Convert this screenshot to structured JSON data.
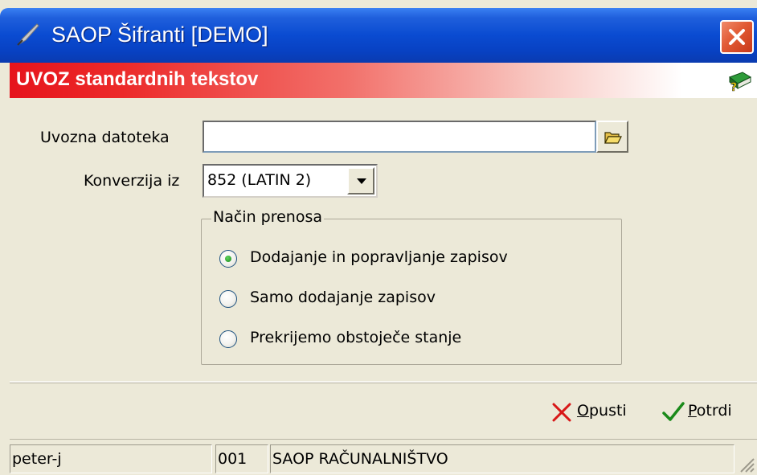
{
  "window": {
    "title": "SAOP Šifranti [DEMO]",
    "titlebar_color": "#0a4bd1",
    "close_icon": "close-icon"
  },
  "header": {
    "title": "UVOZ standardnih tekstov",
    "band_color": "#e6141c",
    "help_icon": "help-book-icon"
  },
  "form": {
    "file_label": "Uvozna datoteka",
    "file_value": "",
    "browse_icon": "folder-open-icon",
    "conversion_label": "Konverzija iz",
    "conversion_value": "852 (LATIN 2)",
    "transfer_group": {
      "legend": "Način prenosa",
      "options": [
        {
          "label": "Dodajanje in popravljanje zapisov",
          "selected": true
        },
        {
          "label": "Samo dodajanje zapisov",
          "selected": false
        },
        {
          "label": "Prekrijemo obstoječe stanje",
          "selected": false
        }
      ]
    }
  },
  "buttons": {
    "cancel": {
      "accel": "O",
      "rest": "pusti",
      "icon": "red-x-icon"
    },
    "confirm": {
      "accel": "P",
      "rest": "otrdi",
      "icon": "green-check-icon"
    }
  },
  "status": {
    "user": "peter-j",
    "company_code": "001",
    "company_name": "SAOP RAČUNALNIŠTVO"
  }
}
